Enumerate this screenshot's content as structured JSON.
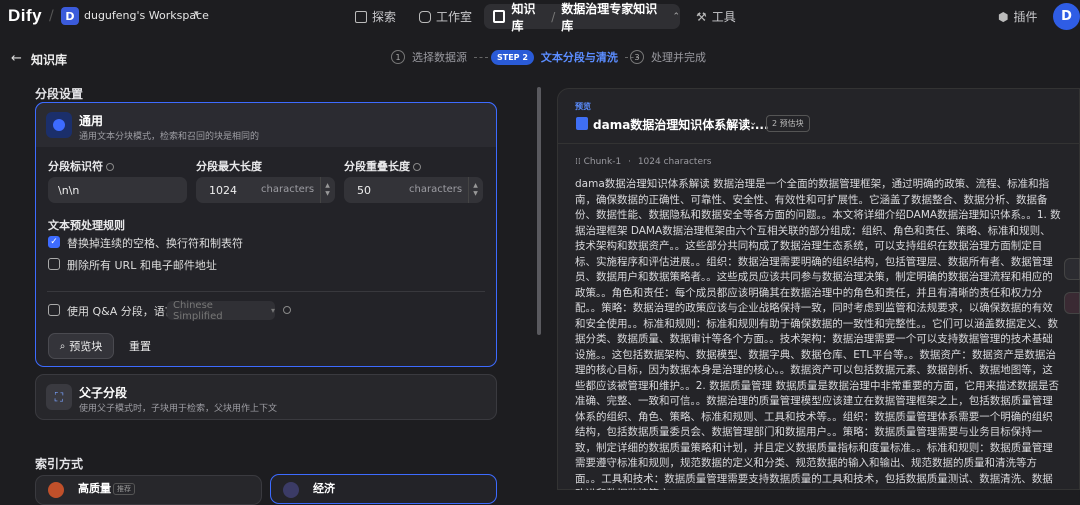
{
  "app": {
    "logo": "Dify",
    "workspace_initial": "D",
    "workspace_name": "dugufeng's Workspace"
  },
  "nav": {
    "explore": "探索",
    "studio": "工作室",
    "knowledge": "知识库",
    "dataset": "数据治理专家知识库",
    "tools": "工具",
    "plugins": "插件",
    "avatar": "D"
  },
  "header": {
    "back_label": "知识库"
  },
  "steps": [
    {
      "num": "1",
      "label": "选择数据源"
    },
    {
      "badge": "STEP 2",
      "label": "文本分段与清洗"
    },
    {
      "num": "3",
      "label": "处理并完成"
    }
  ],
  "segment": {
    "title": "分段设置",
    "general": {
      "title": "通用",
      "desc": "通用文本分块模式，检索和召回的块是相同的"
    },
    "delimiter": {
      "label": "分段标识符",
      "value": "\\n\\n"
    },
    "max_len": {
      "label": "分段最大长度",
      "value": "1024",
      "unit": "characters"
    },
    "overlap": {
      "label": "分段重叠长度",
      "value": "50",
      "unit": "characters"
    },
    "preprocess_title": "文本预处理规则",
    "rule1": "替换掉连续的空格、换行符和制表符",
    "rule2": "删除所有 URL 和电子邮件地址",
    "qa_label": "使用 Q&A 分段，语言",
    "qa_lang": "Chinese Simplified",
    "preview_btn": "预览块",
    "reset_btn": "重置",
    "parent_child": {
      "title": "父子分段",
      "desc": "使用父子模式时，子块用于检索，父块用作上下文"
    }
  },
  "index": {
    "title": "索引方式",
    "high_quality": "高质量",
    "recommend": "推荐",
    "economy": "经济"
  },
  "preview": {
    "label": "预览",
    "doc_title": "dama数据治理知识体系解读....",
    "chunk_count": "2 预估块",
    "chunk_id": "Chunk-1",
    "chunk_chars": "1024 characters",
    "chunk_text": "dama数据治理知识体系解读 数据治理是一个全面的数据管理框架，通过明确的政策、流程、标准和指南，确保数据的正确性、可靠性、安全性、有效性和可扩展性。它涵盖了数据整合、数据分析、数据备份、数据性能、数据隐私和数据安全等各方面的问题。。本文将详细介绍DAMA数据治理知识体系。。1. 数据治理框架 DAMA数据治理框架由六个互相关联的部分组成：组织、角色和责任、策略、标准和规则、技术架构和数据资产。。这些部分共同构成了数据治理生态系统，可以支持组织在数据治理方面制定目标、实施程序和评估进展。。组织：数据治理需要明确的组织结构，包括管理层、数据所有者、数据管理员、数据用户和数据策略者。。这些成员应该共同参与数据治理决策，制定明确的数据治理流程和相应的政策。。角色和责任：每个成员都应该明确其在数据治理中的角色和责任，并且有清晰的责任和权力分配。。策略：数据治理的政策应该与企业战略保持一致，同时考虑到监管和法规要求，以确保数据的有效和安全使用。。标准和规则：标准和规则有助于确保数据的一致性和完整性。。它们可以涵盖数据定义、数据分类、数据质量、数据审计等各个方面。。技术架构：数据治理需要一个可以支持数据管理的技术基础设施。。这包括数据架构、数据模型、数据字典、数据仓库、ETL平台等。。数据资产：数据资产是数据治理的核心目标，因为数据本身是治理的核心。。数据资产可以包括数据元素、数据剖析、数据地图等，这些都应该被管理和维护。。2. 数据质量管理 数据质量是数据治理中非常重要的方面，它用来描述数据是否准确、完整、一致和可信。。数据治理的质量管理模型应该建立在数据管理框架之上，包括数据质量管理体系的组织、角色、策略、标准和规则、工具和技术等。。组织：数据质量管理体系需要一个明确的组织结构，包括数据质量委员会、数据管理部门和数据用户。。策略：数据质量管理需要与业务目标保持一致，制定详细的数据质量策略和计划，并且定义数据质量指标和度量标准。。标准和规则：数据质量管理需要遵守标准和规则，规范数据的定义和分类、规范数据的输入和输出、规范数据的质量和清洗等方面。。工具和技术：数据质量管理需要支持数据质量的工具和技术，包括数据质量测试、数据清洗、数据改进和数据监控等方"
  }
}
